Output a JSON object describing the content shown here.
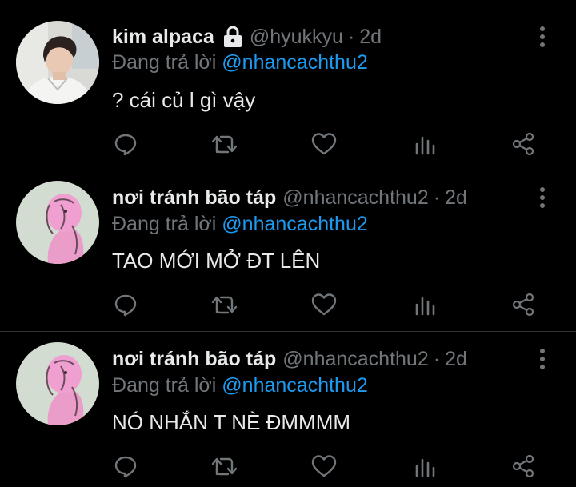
{
  "colors": {
    "background": "#000000",
    "text": "#e7e9ea",
    "secondary": "#71767b",
    "mention": "#1d9bf0",
    "divider": "#2f3336"
  },
  "tweets": [
    {
      "name": "kim alpaca",
      "protected": true,
      "handle": "@hyukkyu",
      "time": "2d",
      "replying_prefix": "Đang trả lời",
      "replying_to": "@nhancachthu2",
      "text": "? cái củ l gì vậy",
      "icons": [
        "reply-icon",
        "retweet-icon",
        "like-icon",
        "analytics-icon",
        "share-icon"
      ]
    },
    {
      "name": "nơi tránh bão táp",
      "protected": false,
      "handle": "@nhancachthu2",
      "time": "2d",
      "replying_prefix": "Đang trả lời",
      "replying_to": "@nhancachthu2",
      "text": "TAO MỚI MỞ ĐT LÊN",
      "icons": [
        "reply-icon",
        "retweet-icon",
        "like-icon",
        "analytics-icon",
        "share-icon"
      ]
    },
    {
      "name": "nơi tránh bão táp",
      "protected": false,
      "handle": "@nhancachthu2",
      "time": "2d",
      "replying_prefix": "Đang trả lời",
      "replying_to": "@nhancachthu2",
      "text": "NÓ NHẮN T NÈ ĐMMMM",
      "icons": [
        "reply-icon",
        "retweet-icon",
        "like-icon",
        "analytics-icon",
        "share-icon"
      ]
    }
  ],
  "separator": "·"
}
